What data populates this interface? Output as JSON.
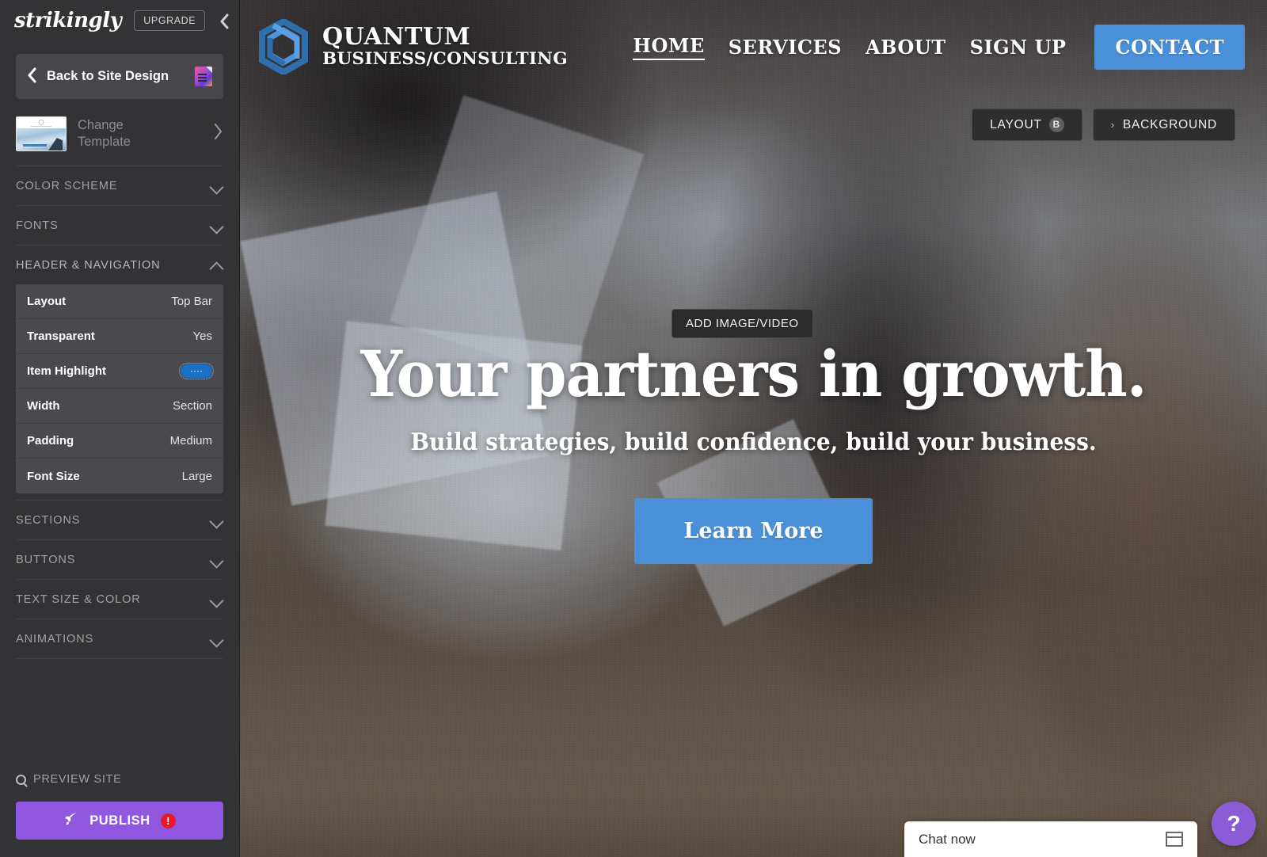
{
  "sidebar": {
    "brand": "strikingly",
    "upgrade_label": "UPGRADE",
    "back_label": "Back to Site Design",
    "template": {
      "label_line1": "Change",
      "label_line2": "Template"
    },
    "sections": [
      {
        "label": "COLOR SCHEME",
        "expanded": false
      },
      {
        "label": "FONTS",
        "expanded": false
      },
      {
        "label": "HEADER & NAVIGATION",
        "expanded": true
      },
      {
        "label": "SECTIONS",
        "expanded": false
      },
      {
        "label": "BUTTONS",
        "expanded": false
      },
      {
        "label": "TEXT SIZE & COLOR",
        "expanded": false
      },
      {
        "label": "ANIMATIONS",
        "expanded": false
      }
    ],
    "header_nav_options": [
      {
        "key": "Layout",
        "value": "Top Bar",
        "type": "text"
      },
      {
        "key": "Transparent",
        "value": "Yes",
        "type": "text"
      },
      {
        "key": "Item Highlight",
        "value": "",
        "type": "toggle"
      },
      {
        "key": "Width",
        "value": "Section",
        "type": "text"
      },
      {
        "key": "Padding",
        "value": "Medium",
        "type": "text"
      },
      {
        "key": "Font Size",
        "value": "Large",
        "type": "text"
      }
    ],
    "preview_label": "PREVIEW SITE",
    "publish_label": "PUBLISH",
    "publish_badge": "!"
  },
  "site": {
    "logo": {
      "title_line1": "QUANTUM",
      "title_line2": "BUSINESS/CONSULTING"
    },
    "nav": [
      {
        "label": "HOME",
        "active": true
      },
      {
        "label": "SERVICES",
        "active": false
      },
      {
        "label": "ABOUT",
        "active": false
      },
      {
        "label": "SIGN UP",
        "active": false
      }
    ],
    "contact_label": "CONTACT",
    "hero": {
      "headline": "Your partners in growth.",
      "subhead": "Build strategies, build confidence, build your business.",
      "cta_label": "Learn More"
    }
  },
  "editor_overlay": {
    "layout_label": "LAYOUT",
    "layout_shortcut": "B",
    "background_label": "BACKGROUND",
    "background_caret": "›",
    "add_media_label": "ADD IMAGE/VIDEO"
  },
  "chat": {
    "label": "Chat now",
    "help_label": "?"
  },
  "colors": {
    "sidebar_bg": "#333335",
    "option_row_bg": "#4a4a4e",
    "accent_blue": "#4a90d9",
    "toggle_blue": "#1c70c4",
    "publish_purple": "#9057e0",
    "alert_red": "#e8172a",
    "help_purple": "#8b5cd6",
    "chip_bg": "#2e2e2e"
  }
}
